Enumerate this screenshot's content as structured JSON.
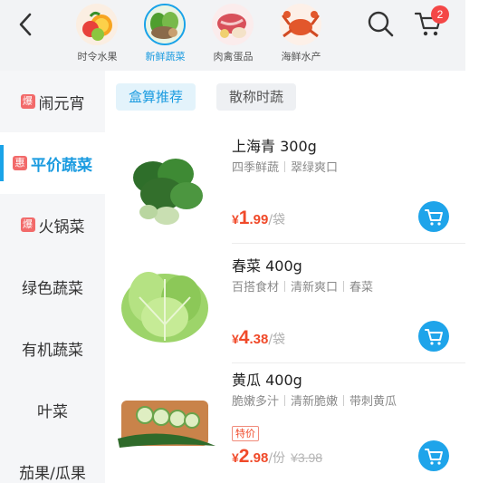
{
  "topbar": {
    "categories": [
      {
        "label": "时令水果",
        "icon": "fruit-icon"
      },
      {
        "label": "新鲜蔬菜",
        "icon": "vegetable-icon",
        "active": true
      },
      {
        "label": "肉禽蛋品",
        "icon": "meat-icon"
      },
      {
        "label": "海鲜水产",
        "icon": "crab-icon"
      }
    ],
    "cart_count": "2"
  },
  "sidebar": {
    "items": [
      {
        "tag": "爆",
        "label": "闹元宵"
      },
      {
        "tag": "惠",
        "label": "平价蔬菜",
        "active": true
      },
      {
        "tag": "爆",
        "label": "火锅菜"
      },
      {
        "label": "绿色蔬菜"
      },
      {
        "label": "有机蔬菜"
      },
      {
        "label": "叶菜"
      },
      {
        "label": "茄果/瓜果"
      }
    ]
  },
  "subtabs": [
    {
      "label": "盒算推荐",
      "active": true
    },
    {
      "label": "散称时蔬"
    }
  ],
  "products": [
    {
      "name": "上海青 300g",
      "tags": [
        "四季鲜蔬",
        "翠绿爽口"
      ],
      "currency": "¥",
      "price_int": "1",
      "price_dec": ".99",
      "unit": "/袋",
      "image": "bok-choy-image"
    },
    {
      "name": "春菜 400g",
      "tags": [
        "百搭食材",
        "清新爽口",
        "春菜"
      ],
      "currency": "¥",
      "price_int": "4",
      "price_dec": ".38",
      "unit": "/袋",
      "image": "lettuce-image"
    },
    {
      "name": "黄瓜 400g",
      "tags": [
        "脆嫩多汁",
        "清新脆嫩",
        "带刺黄瓜"
      ],
      "special": "特价",
      "currency": "¥",
      "price_int": "2",
      "price_dec": ".98",
      "unit": "/份",
      "original_price": "¥3.98",
      "image": "cucumber-image"
    }
  ],
  "colors": {
    "accent": "#1aa3e8",
    "price": "#f04a2a",
    "badge": "#f44747",
    "tag": "#f26a6a"
  }
}
